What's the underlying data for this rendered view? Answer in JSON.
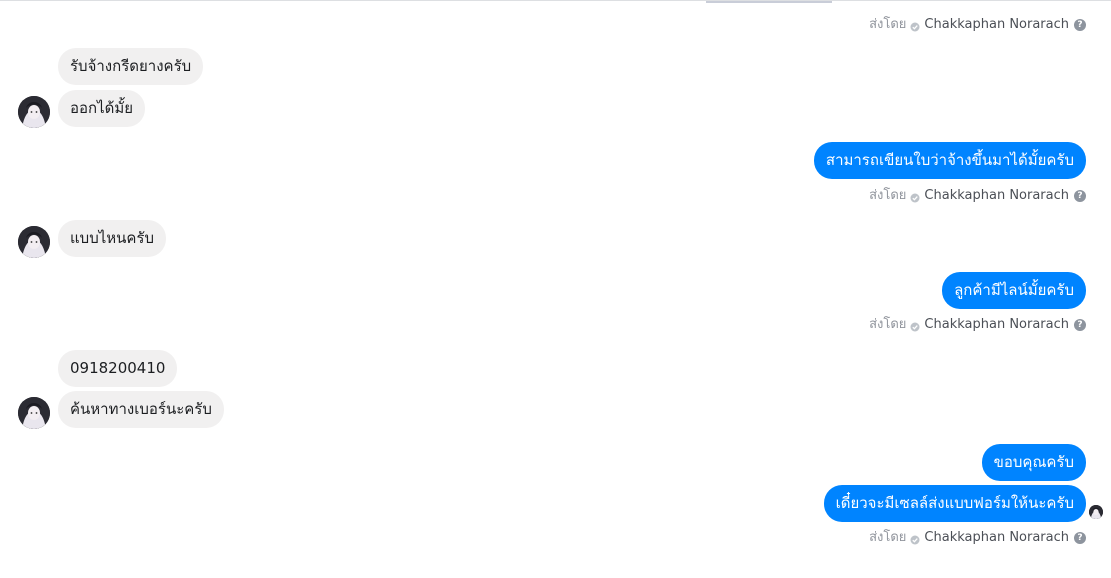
{
  "conversation": {
    "sent_by": {
      "label": "ส่งโดย",
      "name": "Chakkaphan Norarach",
      "help_glyph": "?"
    },
    "messages": [
      {
        "direction": "in",
        "text": "รับจ้างกรีดยางครับ"
      },
      {
        "direction": "in",
        "text": "ออกได้มั้ย"
      },
      {
        "direction": "out",
        "text": "สามารถเขียนใบว่าจ้างขึ้นมาได้มั้ยครับ"
      },
      {
        "direction": "in",
        "text": "แบบไหนครับ"
      },
      {
        "direction": "out",
        "text": "ลูกค้ามีไลน์มั้ยครับ"
      },
      {
        "direction": "in",
        "text": "0918200410"
      },
      {
        "direction": "in",
        "text": "ค้นหาทางเบอร์นะครับ"
      },
      {
        "direction": "out",
        "text": "ขอบคุณครับ"
      },
      {
        "direction": "out",
        "text": "เดี๋ยวจะมีเซลล์ส่งแบบฟอร์มให้นะครับ"
      }
    ]
  },
  "colors": {
    "incoming_bubble": "#f1f0f0",
    "outgoing_bubble": "#0084ff",
    "meta_text": "#90949c"
  },
  "icons": [
    "check-icon",
    "help-icon",
    "avatar"
  ]
}
